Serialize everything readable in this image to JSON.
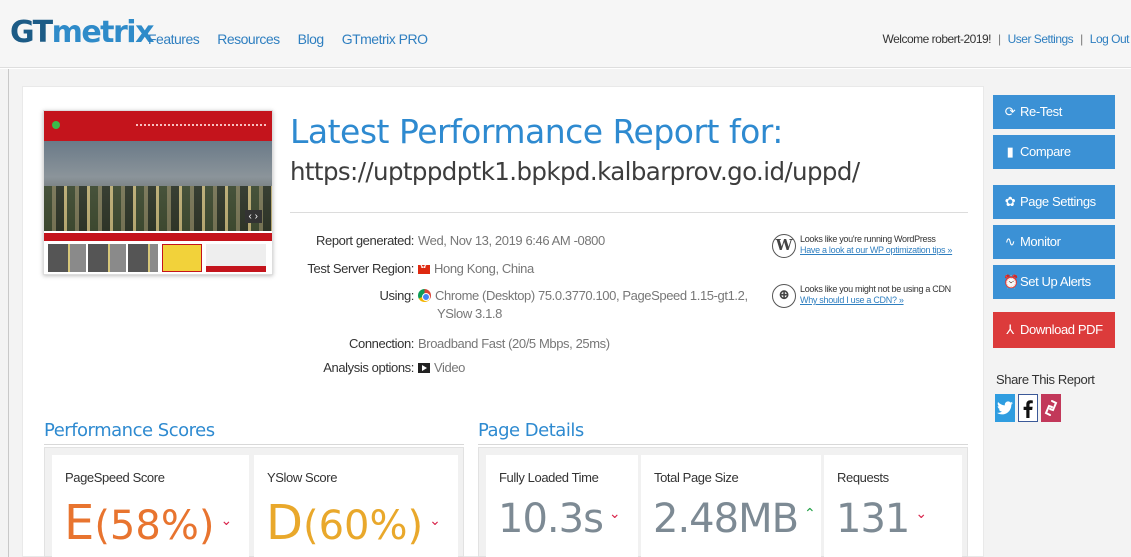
{
  "brand": {
    "logo_gt": "GT",
    "logo_metrix": "metrix"
  },
  "nav": {
    "items": [
      "Features",
      "Resources",
      "Blog",
      "GTmetrix PRO"
    ]
  },
  "account": {
    "welcome": "Welcome robert-2019!",
    "settings": "User Settings",
    "logout": "Log Out",
    "separator": "|"
  },
  "report": {
    "heading": "Latest Performance Report for:",
    "url": "https://uptppdptk1.bpkpd.kalbarprov.go.id/uppd/",
    "details": [
      {
        "label": "Report generated:",
        "value": "Wed, Nov 13, 2019 6:46 AM -0800"
      },
      {
        "label": "Test Server Region:",
        "value": "Hong Kong, China"
      },
      {
        "label": "Using:",
        "value": "Chrome (Desktop) 75.0.3770.100, PageSpeed 1.15-gt1.2,",
        "value2": "YSlow 3.1.8"
      },
      {
        "label": "Connection:",
        "value": "Broadband Fast (20/5 Mbps, 25ms)"
      },
      {
        "label": "Analysis options:",
        "value": "Video"
      }
    ],
    "hints": [
      {
        "text": "Looks like you're running WordPress",
        "link": "Have a look at our WP optimization tips »",
        "icon": "W"
      },
      {
        "text": "Looks like you might not be using a CDN",
        "link": "Why should I use a CDN? »",
        "icon": "⊕"
      }
    ]
  },
  "performance": {
    "title": "Performance Scores",
    "pagespeed": {
      "label": "PageSpeed Score",
      "grade": "E",
      "pct": "(58%)",
      "color": "#e8742f"
    },
    "yslow": {
      "label": "YSlow Score",
      "grade": "D",
      "pct": "(60%)",
      "color": "#e9a82b"
    }
  },
  "page_details": {
    "title": "Page Details",
    "fully_loaded": {
      "label": "Fully Loaded Time",
      "value": "10.3s",
      "trend": "down"
    },
    "total_size": {
      "label": "Total Page Size",
      "value": "2.48MB",
      "trend": "up"
    },
    "requests": {
      "label": "Requests",
      "value": "131",
      "trend": "down"
    }
  },
  "sidebar": {
    "buttons": [
      {
        "label": "Re-Test",
        "icon": "refresh-icon"
      },
      {
        "label": "Compare",
        "icon": "compare-icon"
      },
      {
        "label": "Page Settings",
        "icon": "gear-icon"
      },
      {
        "label": "Monitor",
        "icon": "pulse-icon"
      },
      {
        "label": "Set Up Alerts",
        "icon": "alarm-icon"
      },
      {
        "label": "Download PDF",
        "icon": "pdf-icon"
      }
    ],
    "share_label": "Share This Report",
    "social": [
      {
        "name": "twitter",
        "color": "#2f9de0"
      },
      {
        "name": "facebook",
        "color": "#3b5998"
      },
      {
        "name": "link",
        "color": "#c2385a"
      }
    ]
  },
  "glyphs": {
    "caret_down": "⌄",
    "caret_up": "⌃"
  }
}
